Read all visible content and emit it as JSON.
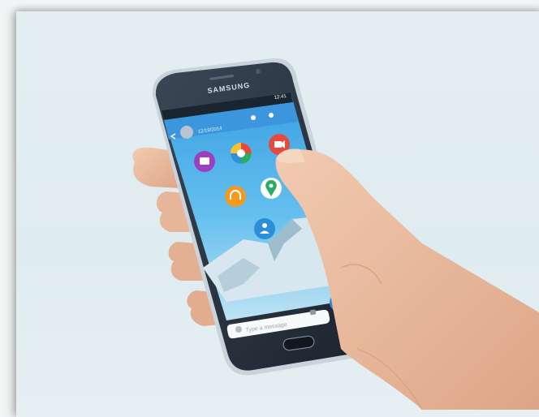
{
  "phone": {
    "brand": "SAMSUNG",
    "status_time": "12:41",
    "chat_date": "12/19/2014",
    "message_placeholder": "Type a message"
  },
  "attachment_icons": [
    "gallery-icon",
    "camera-icon",
    "video-icon",
    "audio-icon",
    "location-icon",
    "contact-icon"
  ],
  "colors": {
    "background": "#e1edf0",
    "app_bar": "#3b96dd",
    "screen_sky": "#3aa6e8",
    "gallery": "#9c3fc0",
    "camera": "#f0f0f0",
    "video": "#e64a3c",
    "audio": "#f39a1e",
    "location": "#ffffff",
    "contact": "#2a8fd6",
    "mic": "#2f86cc"
  }
}
